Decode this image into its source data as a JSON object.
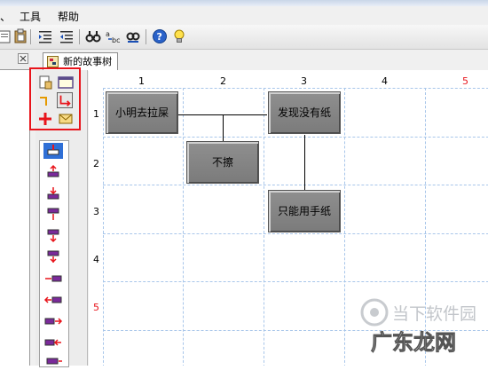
{
  "menu": [
    "、",
    "工具",
    "帮助"
  ],
  "tab": {
    "label": "新的故事树"
  },
  "grid": {
    "columns": [
      "1",
      "2",
      "3",
      "4",
      "5"
    ],
    "rows": [
      "1",
      "2",
      "3",
      "4",
      "5"
    ],
    "highlight_color": "#e8141b"
  },
  "nodes": [
    {
      "id": "n1",
      "label": "小明去拉屎"
    },
    {
      "id": "n2",
      "label": "发现没有纸"
    },
    {
      "id": "n3",
      "label": "不擦"
    },
    {
      "id": "n4",
      "label": "只能用手纸"
    }
  ],
  "watermark": {
    "line1": "当下软件园",
    "line2": "广东龙网"
  },
  "icons": {
    "toolbar": [
      "paste-icon",
      "clipboard-icon",
      "indent-icon",
      "outdent-icon",
      "find-icon",
      "replace-icon",
      "find-next-icon",
      "help-icon",
      "tip-bulb-icon"
    ],
    "palette": [
      "new-page-icon",
      "window-icon",
      "connector-icon",
      "elbow-connector-icon",
      "add-icon",
      "mail-icon"
    ],
    "tools": [
      "tool-top-insert-icon",
      "tool-up-icon",
      "tool-down-icon",
      "tool-top-icon",
      "tool-bottom-icon",
      "tool-middle-icon",
      "tool-left-icon",
      "tool-left-insert-icon",
      "tool-right-icon",
      "tool-right-insert-icon",
      "tool-end-icon"
    ]
  },
  "colors": {
    "accent_red": "#e8141b",
    "grid_blue": "#a8c6ea",
    "node_gray": "#858585"
  }
}
